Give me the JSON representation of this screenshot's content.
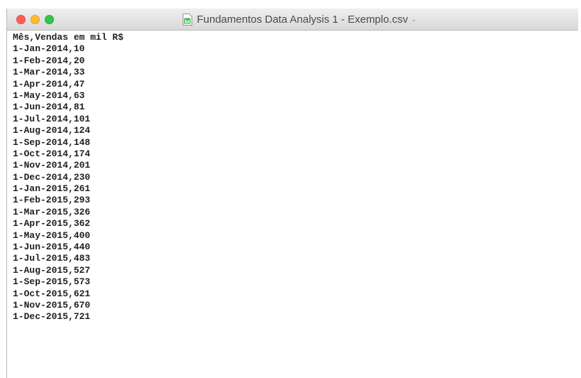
{
  "window": {
    "title": "Fundamentos Data Analysis 1 - Exemplo.csv",
    "title_chevron": "⌄",
    "file_icon": "numbers-spreadsheet-icon",
    "traffic_lights": {
      "close": "#fc5f57",
      "minimize": "#fdbc2e",
      "zoom": "#33c748"
    }
  },
  "file": {
    "lines": [
      "Mês,Vendas em mil R$",
      "1-Jan-2014,10",
      "1-Feb-2014,20",
      "1-Mar-2014,33",
      "1-Apr-2014,47",
      "1-May-2014,63",
      "1-Jun-2014,81",
      "1-Jul-2014,101",
      "1-Aug-2014,124",
      "1-Sep-2014,148",
      "1-Oct-2014,174",
      "1-Nov-2014,201",
      "1-Dec-2014,230",
      "1-Jan-2015,261",
      "1-Feb-2015,293",
      "1-Mar-2015,326",
      "1-Apr-2015,362",
      "1-May-2015,400",
      "1-Jun-2015,440",
      "1-Jul-2015,483",
      "1-Aug-2015,527",
      "1-Sep-2015,573",
      "1-Oct-2015,621",
      "1-Nov-2015,670",
      "1-Dec-2015,721"
    ]
  }
}
